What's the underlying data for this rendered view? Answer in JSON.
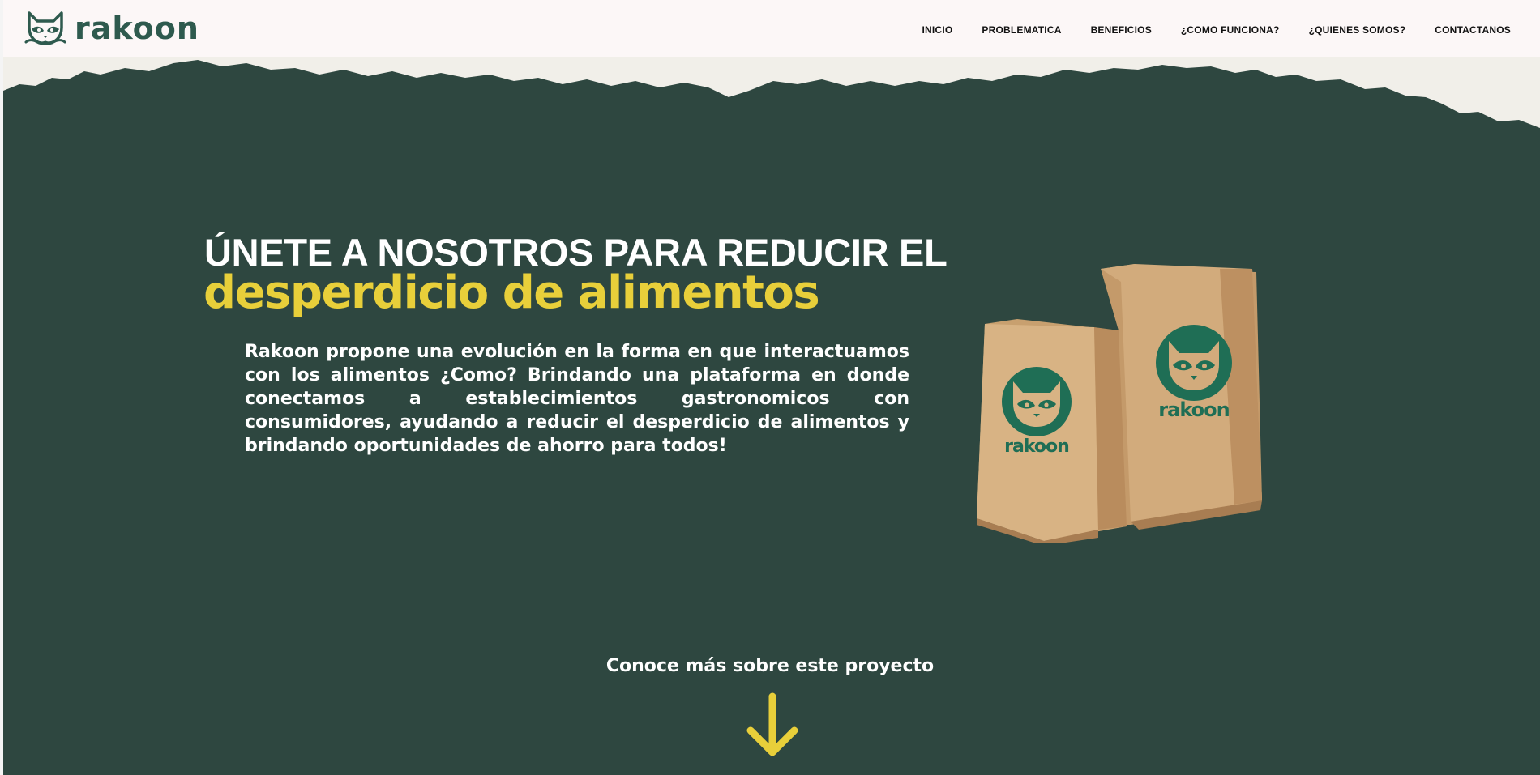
{
  "brand": {
    "name": "rakoon",
    "icon": "raccoon-icon",
    "colors": {
      "primary": "#2e4740",
      "accent": "#e8cf3a",
      "logo": "#2e5a4e",
      "bag_print": "#1f6e55"
    }
  },
  "nav": {
    "items": [
      {
        "label": "INICIO"
      },
      {
        "label": "PROBLEMATICA"
      },
      {
        "label": "BENEFICIOS"
      },
      {
        "label": "¿COMO FUNCIONA?"
      },
      {
        "label": "¿QUIENES SOMOS?"
      },
      {
        "label": "CONTACTANOS"
      }
    ]
  },
  "hero": {
    "headline_top": "ÚNETE A NOSOTROS PARA REDUCIR EL",
    "headline_highlight": "desperdicio de alimentos",
    "description": "Rakoon propone una evolución en la forma en que interactuamos con los alimentos ¿Como? Brindando una plataforma en donde conectamos a establecimientos gastronomicos con consumidores, ayudando a reducir el desperdicio de alimentos y brindando oportunidades de ahorro para todos!",
    "bag_label": "rakoon",
    "image": "paper-bags-image"
  },
  "cta": {
    "label": "Conoce más sobre este proyecto",
    "icon": "arrow-down-icon"
  }
}
